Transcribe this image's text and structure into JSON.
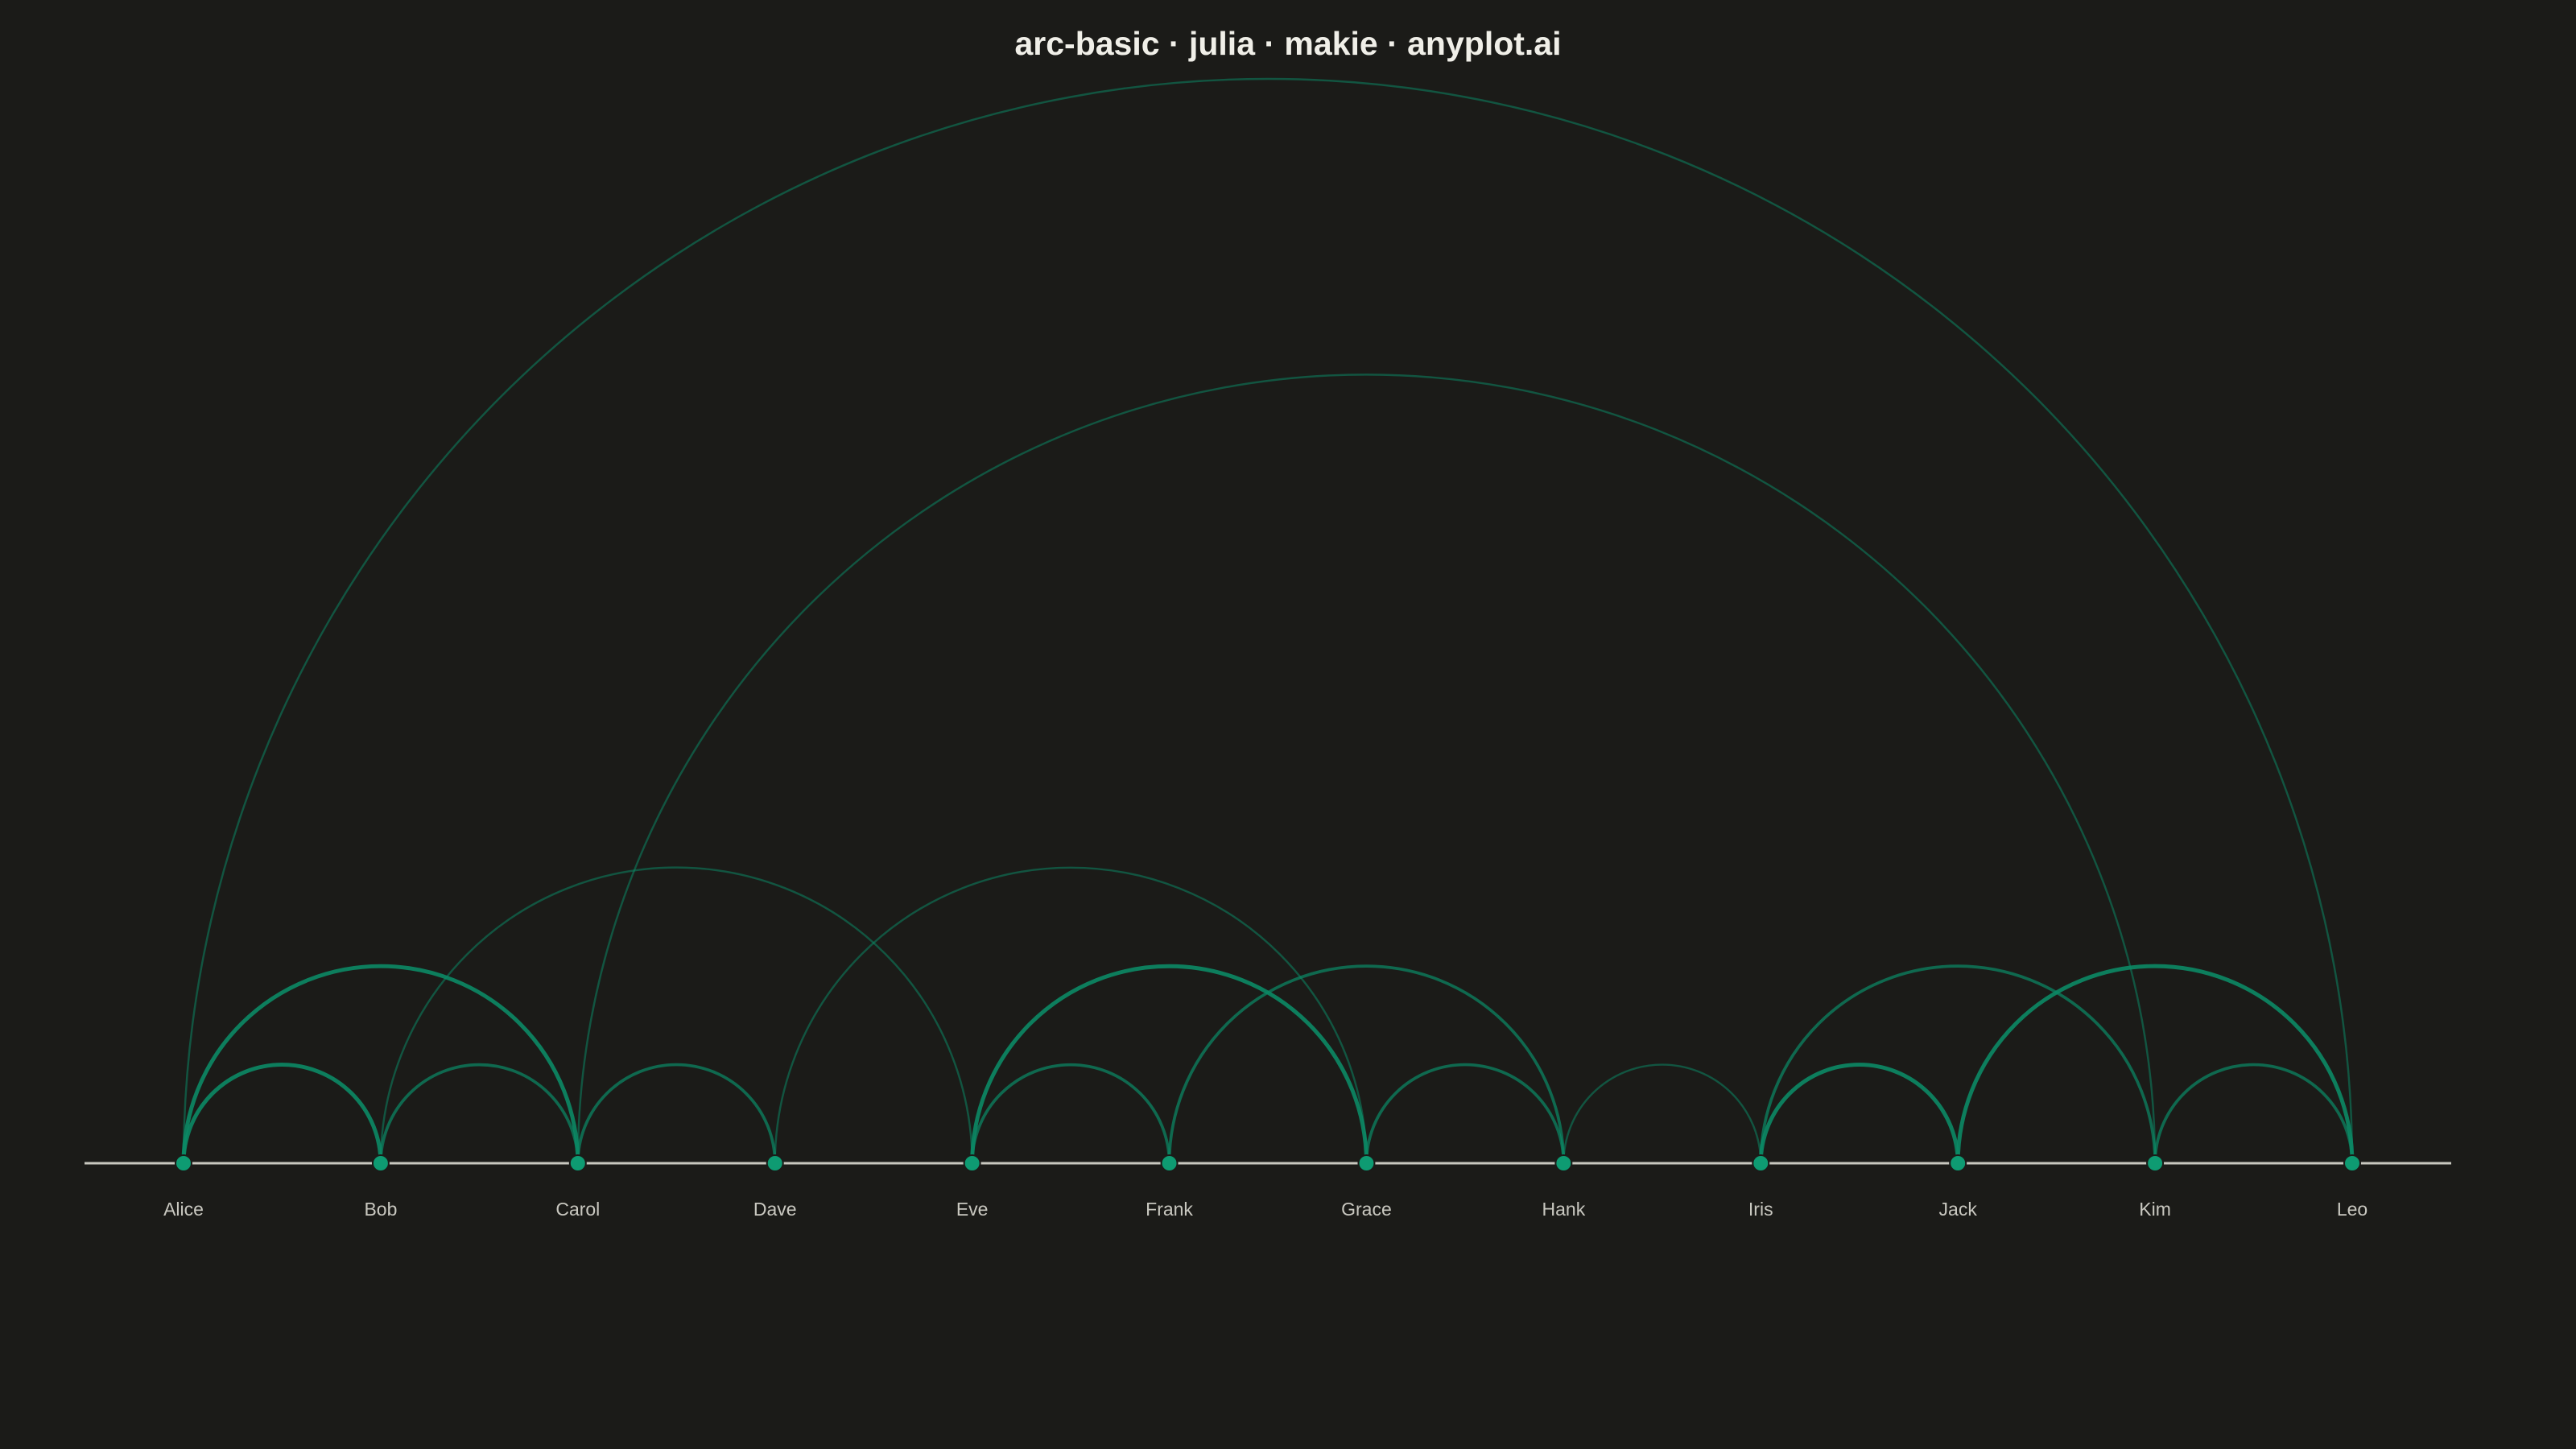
{
  "title": "arc-basic · julia · makie · anyplot.ai",
  "colors": {
    "background": "#1b1b18",
    "accent": "#0b8a66",
    "node_fill": "#0e9b72",
    "baseline": "#c9c8c0",
    "label": "#c9c8c0",
    "title": "#f0efe8"
  },
  "chart_data": {
    "type": "arc",
    "nodes": [
      "Alice",
      "Bob",
      "Carol",
      "Dave",
      "Eve",
      "Frank",
      "Grace",
      "Hank",
      "Iris",
      "Jack",
      "Kim",
      "Leo"
    ],
    "edges": [
      {
        "source": "Alice",
        "target": "Bob",
        "weight": 3
      },
      {
        "source": "Alice",
        "target": "Carol",
        "weight": 3
      },
      {
        "source": "Alice",
        "target": "Leo",
        "weight": 1
      },
      {
        "source": "Bob",
        "target": "Carol",
        "weight": 2
      },
      {
        "source": "Bob",
        "target": "Eve",
        "weight": 1
      },
      {
        "source": "Carol",
        "target": "Dave",
        "weight": 2
      },
      {
        "source": "Carol",
        "target": "Kim",
        "weight": 1
      },
      {
        "source": "Dave",
        "target": "Grace",
        "weight": 1
      },
      {
        "source": "Eve",
        "target": "Frank",
        "weight": 2
      },
      {
        "source": "Eve",
        "target": "Grace",
        "weight": 3
      },
      {
        "source": "Frank",
        "target": "Hank",
        "weight": 2
      },
      {
        "source": "Grace",
        "target": "Hank",
        "weight": 2
      },
      {
        "source": "Hank",
        "target": "Iris",
        "weight": 1
      },
      {
        "source": "Iris",
        "target": "Jack",
        "weight": 3
      },
      {
        "source": "Iris",
        "target": "Kim",
        "weight": 2
      },
      {
        "source": "Jack",
        "target": "Leo",
        "weight": 3
      },
      {
        "source": "Kim",
        "target": "Leo",
        "weight": 2
      }
    ]
  }
}
